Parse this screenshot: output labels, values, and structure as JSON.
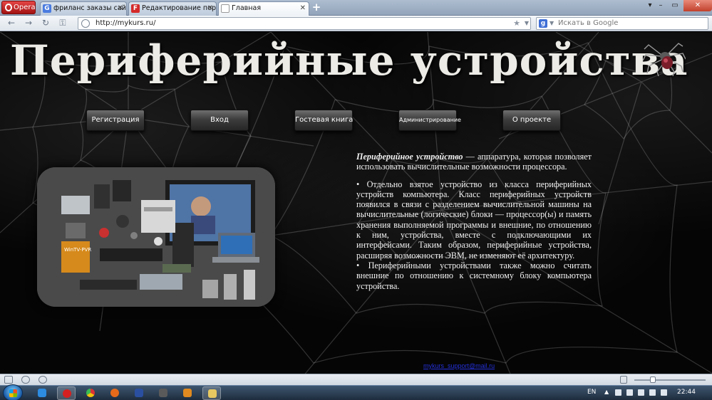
{
  "browser": {
    "menu_label": "Opera",
    "tabs": [
      {
        "label": "фриланс заказы сайто...",
        "favicon": "G",
        "favicon_color": "#4a7be0",
        "active": false
      },
      {
        "label": "Редактирование порт...",
        "favicon": "F",
        "favicon_color": "#d42a2a",
        "active": false
      },
      {
        "label": "Главная",
        "favicon": "",
        "favicon_color": "#ffffff",
        "active": true
      }
    ],
    "address": "http://mykurs.ru/",
    "search_placeholder": "Искать в Google"
  },
  "site": {
    "title": "Периферийные устройства",
    "nav": [
      {
        "label": "Регистрация"
      },
      {
        "label": "Вход"
      },
      {
        "label": "Гостевая книга"
      },
      {
        "label": "Администрирование"
      },
      {
        "label": "О проекте"
      }
    ],
    "article": {
      "term": "Периферийное устройство",
      "intro": " — аппаратура, которая позволяет использовать вычислительные возможности процессора.",
      "items": [
        "• Отдельно взятое устройство из класса периферийных устройств компьютера. Класс периферийных устройств появился в связи с разделением вычислительной машины на вычислительные (логические) блоки — процессор(ы) и память хранения выполняемой программы и внешние, по отношению к ним, устройства, вместе с подключающими их интерфейсами. Таким образом, периферийные устройства, расширяя возможности ЭВМ, не изменяют её архитектуру.",
        "• Периферийными устройствами также можно считать внешние по отношению к системному блоку компьютера устройства."
      ]
    },
    "footer_email": "mykurs_support@mail.ru",
    "collage_box_label": "WinTV-PVR"
  },
  "taskbar": {
    "language": "EN",
    "time": "22:44"
  },
  "colors": {
    "page_background": "#050505",
    "title_text": "#ecebe6",
    "link": "#2430d8"
  }
}
